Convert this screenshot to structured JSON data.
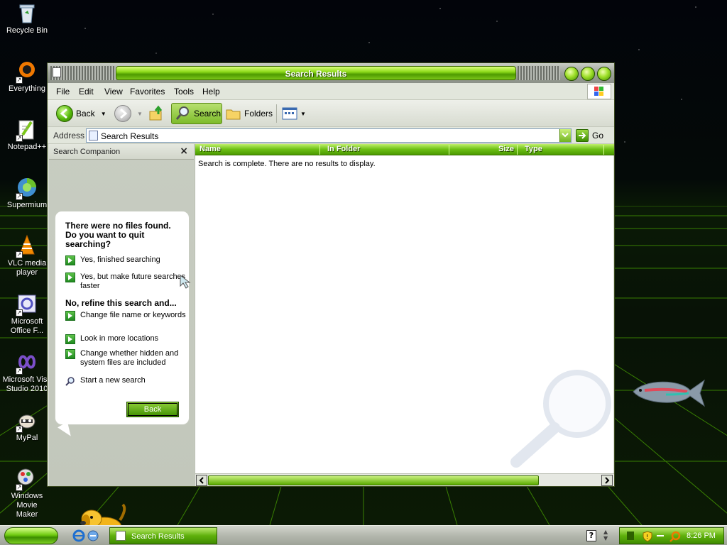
{
  "desktop": {
    "icons": [
      {
        "label_line1": "Recycle Bin",
        "label_line2": ""
      },
      {
        "label_line1": "Everything",
        "label_line2": ""
      },
      {
        "label_line1": "Notepad++",
        "label_line2": ""
      },
      {
        "label_line1": "Supermium",
        "label_line2": ""
      },
      {
        "label_line1": "VLC media",
        "label_line2": "player"
      },
      {
        "label_line1": "Microsoft",
        "label_line2": "Office F..."
      },
      {
        "label_line1": "Microsoft Visu",
        "label_line2": "Studio 2010"
      },
      {
        "label_line1": "MyPal",
        "label_line2": ""
      },
      {
        "label_line1": "Windows Movie",
        "label_line2": "Maker"
      }
    ]
  },
  "window": {
    "title": "Search Results",
    "menu": [
      "File",
      "Edit",
      "View",
      "Favorites",
      "Tools",
      "Help"
    ],
    "toolbar": {
      "back_label": "Back",
      "search_label": "Search",
      "folders_label": "Folders"
    },
    "address": {
      "label": "Address",
      "value": "Search Results",
      "go_label": "Go"
    },
    "companion": {
      "header": "Search Companion",
      "close_glyph": "×",
      "question": "There were no files found. Do you want to quit searching?",
      "options_quit": [
        {
          "text": "Yes, finished searching"
        },
        {
          "text": "Yes, but make future searches faster"
        }
      ],
      "refine_heading": "No, refine this search and...",
      "options_refine": [
        {
          "text": "Change file name or keywords"
        },
        {
          "text": "Look in more locations"
        },
        {
          "text": "Change whether hidden and system files are included"
        }
      ],
      "new_search": "Start a new search",
      "back_button": "Back"
    },
    "results": {
      "columns": [
        "Name",
        "In Folder",
        "Size",
        "Type"
      ],
      "message": "Search is complete. There are no results to display."
    }
  },
  "taskbar": {
    "task_button": "Search Results",
    "clock": "8:26 PM",
    "help_glyph": "?"
  },
  "colors": {
    "accent": "#6cbf14",
    "accent_dark": "#3d8e00",
    "title_text": "#ffffff"
  }
}
